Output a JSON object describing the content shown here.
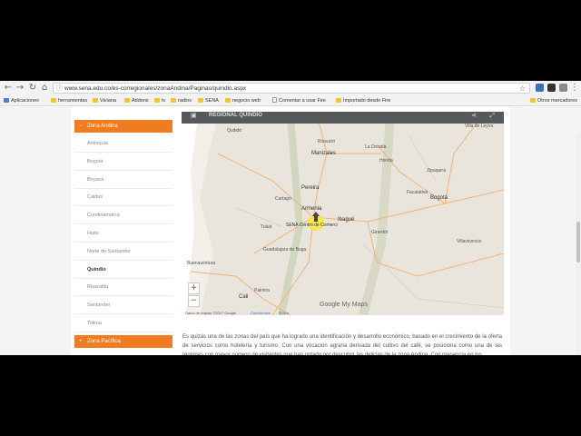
{
  "browser": {
    "url": "www.sena.edu.co/es-co/regionales/zonaAndina/Paginas/quindio.aspx"
  },
  "bookmarks": [
    {
      "label": "Aplicaciones",
      "icon": "apps-icon"
    },
    {
      "label": "herramientas",
      "icon": "folder-icon"
    },
    {
      "label": "Viviana",
      "icon": "folder-icon"
    },
    {
      "label": "Addons",
      "icon": "folder-icon"
    },
    {
      "label": "tv",
      "icon": "folder-icon"
    },
    {
      "label": "radios",
      "icon": "folder-icon"
    },
    {
      "label": "SENA",
      "icon": "folder-icon"
    },
    {
      "label": "negocio web",
      "icon": "folder-icon"
    },
    {
      "label": "Comentar a usar Fire",
      "icon": "page-icon"
    },
    {
      "label": "Importado desde Fire",
      "icon": "folder-icon"
    },
    {
      "label": "Otros marcadores",
      "icon": "folder-icon"
    }
  ],
  "sidebar": {
    "zone_andina": "Zona Andina",
    "items": [
      "Antioquia",
      "Bogotá",
      "Boyacá",
      "Caldas",
      "Cundinamarca",
      "Huila",
      "Norte de Santander",
      "Quindío",
      "Risaralda",
      "Santander",
      "Tolima"
    ],
    "active_item": "Quindío",
    "zone_pacifica": "Zona Pacífica"
  },
  "map": {
    "title": "REGIONAL QUINDÍO",
    "marker_label": "SENA Centro de Comerci",
    "cities": [
      {
        "name": "Quibdó",
        "size": "small"
      },
      {
        "name": "Villa de Leyva",
        "size": "small"
      },
      {
        "name": "Riosucio",
        "size": "small"
      },
      {
        "name": "La Dorada",
        "size": "small"
      },
      {
        "name": "Honda",
        "size": "small"
      },
      {
        "name": "Manizales",
        "size": "big"
      },
      {
        "name": "Zipaquirá",
        "size": "small"
      },
      {
        "name": "Pereira",
        "size": "big"
      },
      {
        "name": "Cartago",
        "size": "small"
      },
      {
        "name": "Facatativá",
        "size": "small"
      },
      {
        "name": "Bogotá",
        "size": "big"
      },
      {
        "name": "Armenia",
        "size": "big"
      },
      {
        "name": "Ibagué",
        "size": "big"
      },
      {
        "name": "Girardot",
        "size": "small"
      },
      {
        "name": "Tuluá",
        "size": "small"
      },
      {
        "name": "Villavicencio",
        "size": "small"
      },
      {
        "name": "Guadalajara de Buga",
        "size": "small"
      },
      {
        "name": "Buenaventura",
        "size": "small"
      },
      {
        "name": "Palmira",
        "size": "small"
      },
      {
        "name": "Cali",
        "size": "big"
      }
    ],
    "footer": {
      "data": "Datos de mapas ©2017 Google",
      "terms": "Condiciones",
      "scale": "20 km"
    },
    "logo": "Google My Maps"
  },
  "paragraph": "Es quizás una de las zonas del país que ha logrado una identificación y desarrollo económico, basado en el crecimiento de la oferta de servicios como hotelería y turismo.  Con una vocación agraria derivada del cultivo del café, se posiciona como una de las regiones con mayor número de visitantes que han optado por descubrir las delicias de la zona Andina. Con presencia en los"
}
